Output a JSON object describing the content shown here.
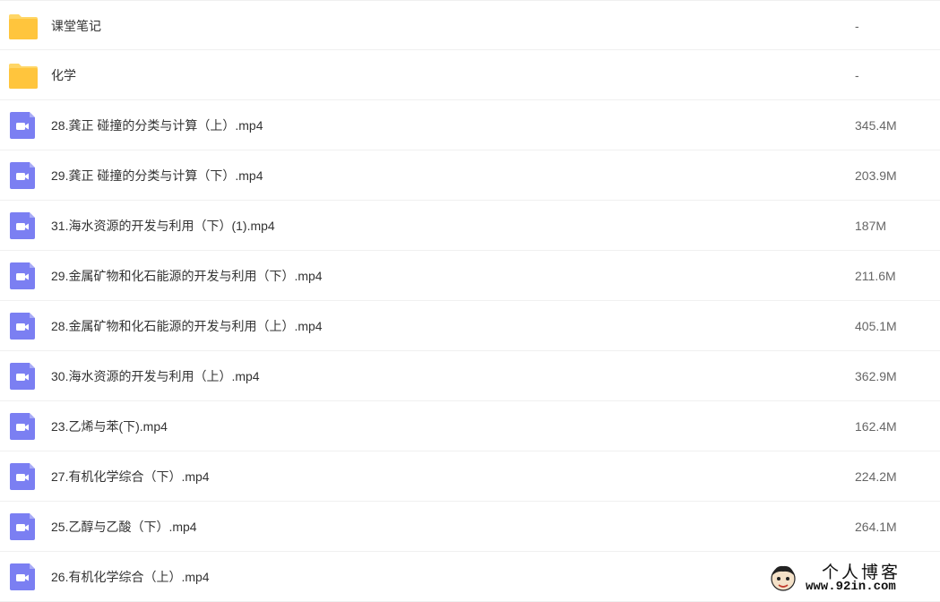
{
  "files": [
    {
      "type": "folder",
      "icon": "folder-icon",
      "name": "课堂笔记",
      "size": "-"
    },
    {
      "type": "folder",
      "icon": "folder-icon",
      "name": "化学",
      "size": "-"
    },
    {
      "type": "video",
      "icon": "video-file-icon",
      "name": "28.龚正 碰撞的分类与计算（上）.mp4",
      "size": "345.4M"
    },
    {
      "type": "video",
      "icon": "video-file-icon",
      "name": "29.龚正 碰撞的分类与计算（下）.mp4",
      "size": "203.9M"
    },
    {
      "type": "video",
      "icon": "video-file-icon",
      "name": "31.海水资源的开发与利用（下）(1).mp4",
      "size": "187M"
    },
    {
      "type": "video",
      "icon": "video-file-icon",
      "name": "29.金属矿物和化石能源的开发与利用（下）.mp4",
      "size": "211.6M"
    },
    {
      "type": "video",
      "icon": "video-file-icon",
      "name": "28.金属矿物和化石能源的开发与利用（上）.mp4",
      "size": "405.1M"
    },
    {
      "type": "video",
      "icon": "video-file-icon",
      "name": "30.海水资源的开发与利用（上）.mp4",
      "size": "362.9M"
    },
    {
      "type": "video",
      "icon": "video-file-icon",
      "name": "23.乙烯与苯(下).mp4",
      "size": "162.4M"
    },
    {
      "type": "video",
      "icon": "video-file-icon",
      "name": "27.有机化学综合（下）.mp4",
      "size": "224.2M"
    },
    {
      "type": "video",
      "icon": "video-file-icon",
      "name": "25.乙醇与乙酸（下）.mp4",
      "size": "264.1M"
    },
    {
      "type": "video",
      "icon": "video-file-icon",
      "name": "26.有机化学综合（上）.mp4",
      "size": ""
    }
  ],
  "watermark": {
    "title": "个人博客",
    "url": "www.92in.com"
  },
  "colors": {
    "folder": "#FFC53D",
    "folder_tab": "#FFD666",
    "video": "#7B7FF2",
    "text": "#333333",
    "size_text": "#666666",
    "row_border": "#F0F0F0"
  }
}
